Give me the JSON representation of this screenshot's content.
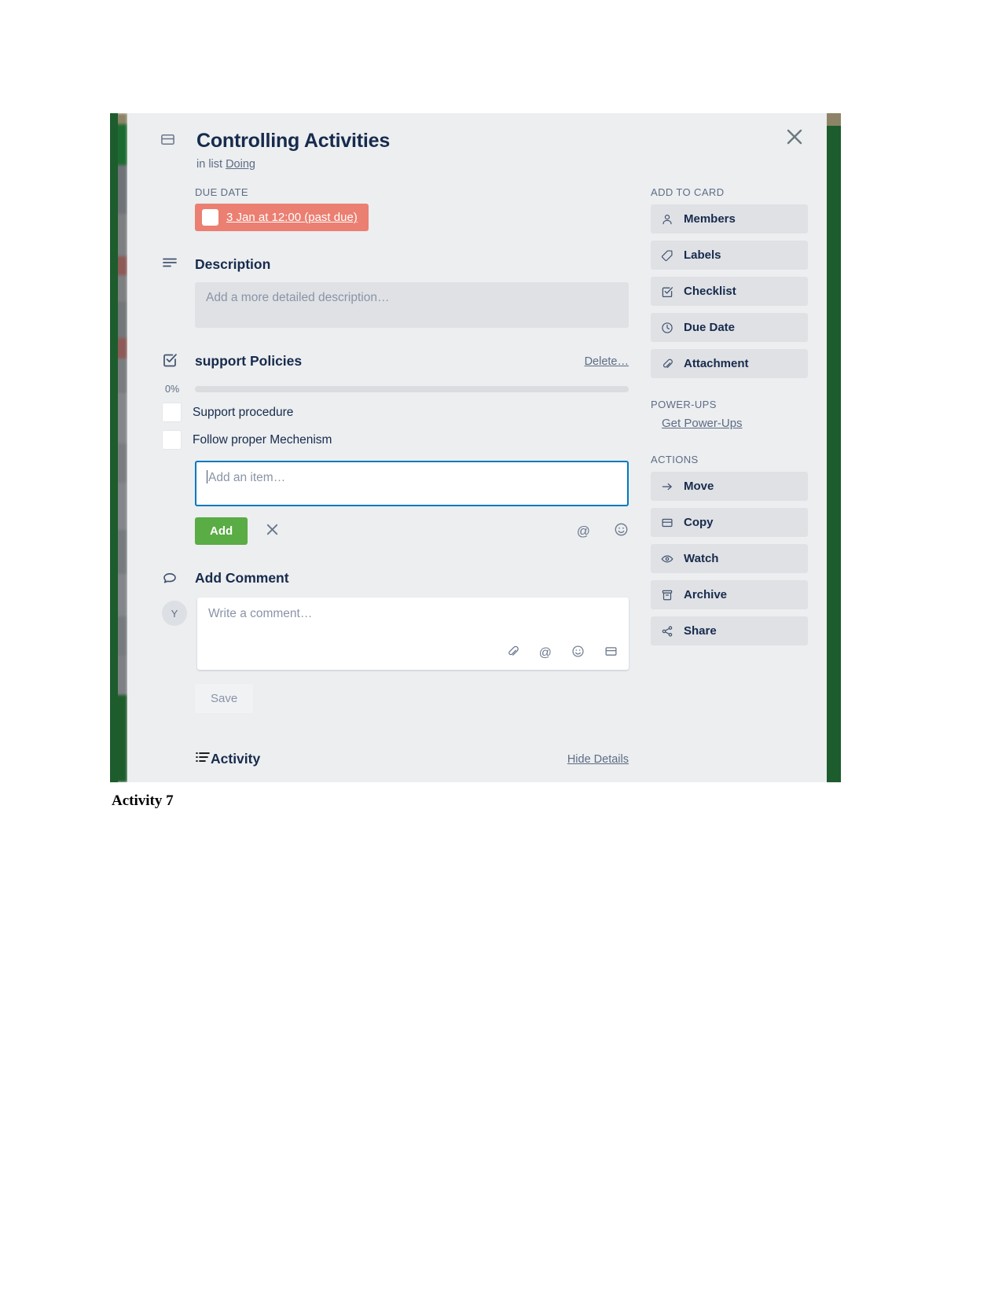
{
  "card": {
    "title": "Controlling Activities",
    "in_list_prefix": "in list",
    "list_name": "Doing",
    "close_label": "×"
  },
  "due_date": {
    "caption": "DUE DATE",
    "value": "3 Jan at 12:00 (past due)",
    "badge_color": "#eb7f71",
    "checked": false
  },
  "description": {
    "title": "Description",
    "placeholder": "Add a more detailed description…"
  },
  "checklist": {
    "title": "support Policies",
    "delete_label": "Delete…",
    "progress_pct": "0%",
    "progress_value": 0,
    "items": [
      {
        "label": "Support procedure",
        "checked": false
      },
      {
        "label": "Follow proper Mechenism",
        "checked": false
      }
    ],
    "new_item_placeholder": "Add an item…",
    "add_label": "Add",
    "cancel_label": "✕",
    "add_button_color": "#5aac44",
    "icons": [
      {
        "name": "mention-icon",
        "glyph": "@"
      },
      {
        "name": "emoji-icon",
        "glyph": "☺"
      }
    ]
  },
  "comment": {
    "title": "Add Comment",
    "avatar_initial": "Y",
    "placeholder": "Write a comment…",
    "save_label": "Save",
    "icons": [
      {
        "name": "attachment-icon",
        "glyph": "🖇"
      },
      {
        "name": "mention-icon",
        "glyph": "@"
      },
      {
        "name": "emoji-icon",
        "glyph": "☺"
      },
      {
        "name": "card-icon",
        "glyph": "🗔"
      }
    ]
  },
  "activity": {
    "title": "Activity",
    "hide_details_label": "Hide Details"
  },
  "sidebar": {
    "add_to_card_caption": "ADD TO CARD",
    "add_to_card": [
      {
        "label": "Members",
        "icon": "member-icon"
      },
      {
        "label": "Labels",
        "icon": "label-tag-icon"
      },
      {
        "label": "Checklist",
        "icon": "checklist-icon"
      },
      {
        "label": "Due Date",
        "icon": "clock-icon"
      },
      {
        "label": "Attachment",
        "icon": "paperclip-icon"
      }
    ],
    "power_ups_caption": "POWER-UPS",
    "power_ups_link": "Get Power-Ups",
    "actions_caption": "ACTIONS",
    "actions": [
      {
        "label": "Move",
        "icon": "arrow-right-icon"
      },
      {
        "label": "Copy",
        "icon": "copy-card-icon"
      },
      {
        "label": "Watch",
        "icon": "eye-icon"
      },
      {
        "label": "Archive",
        "icon": "archive-box-icon"
      },
      {
        "label": "Share",
        "icon": "share-icon"
      }
    ]
  },
  "page": {
    "caption": "Activity 7"
  }
}
